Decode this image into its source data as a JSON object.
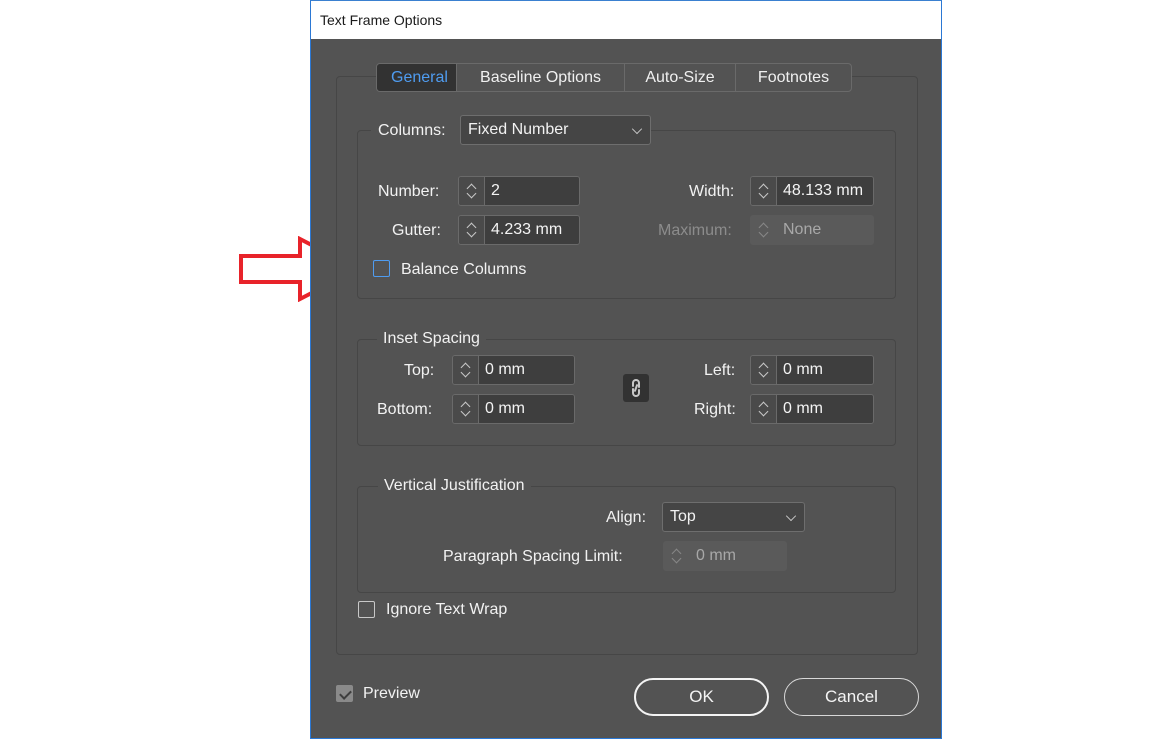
{
  "window": {
    "title": "Text Frame Options"
  },
  "tabs": [
    {
      "label": "General",
      "active": true
    },
    {
      "label": "Baseline Options",
      "active": false
    },
    {
      "label": "Auto-Size",
      "active": false
    },
    {
      "label": "Footnotes",
      "active": false
    }
  ],
  "columns": {
    "label": "Columns:",
    "type_value": "Fixed Number",
    "number_label": "Number:",
    "number_value": "2",
    "gutter_label": "Gutter:",
    "gutter_value": "4.233 mm",
    "width_label": "Width:",
    "width_value": "48.133 mm",
    "maximum_label": "Maximum:",
    "maximum_value": "None",
    "maximum_enabled": false,
    "balance_label": "Balance Columns",
    "balance_checked": false
  },
  "inset_spacing": {
    "legend": "Inset Spacing",
    "top_label": "Top:",
    "top_value": "0 mm",
    "bottom_label": "Bottom:",
    "bottom_value": "0 mm",
    "left_label": "Left:",
    "left_value": "0 mm",
    "right_label": "Right:",
    "right_value": "0 mm",
    "link_icon": "chain-link-icon"
  },
  "vertical_justification": {
    "legend": "Vertical Justification",
    "align_label": "Align:",
    "align_value": "Top",
    "para_spacing_label": "Paragraph Spacing Limit:",
    "para_spacing_value": "0 mm",
    "para_spacing_enabled": false
  },
  "ignore_text_wrap": {
    "label": "Ignore Text Wrap",
    "checked": false
  },
  "preview": {
    "label": "Preview",
    "checked": true
  },
  "buttons": {
    "ok": "OK",
    "cancel": "Cancel"
  },
  "annotation": {
    "arrow_color": "#e8232a",
    "points_to": "Balance Columns"
  },
  "colors": {
    "accent": "#4f9cf0",
    "dialog_bg": "#535353"
  }
}
